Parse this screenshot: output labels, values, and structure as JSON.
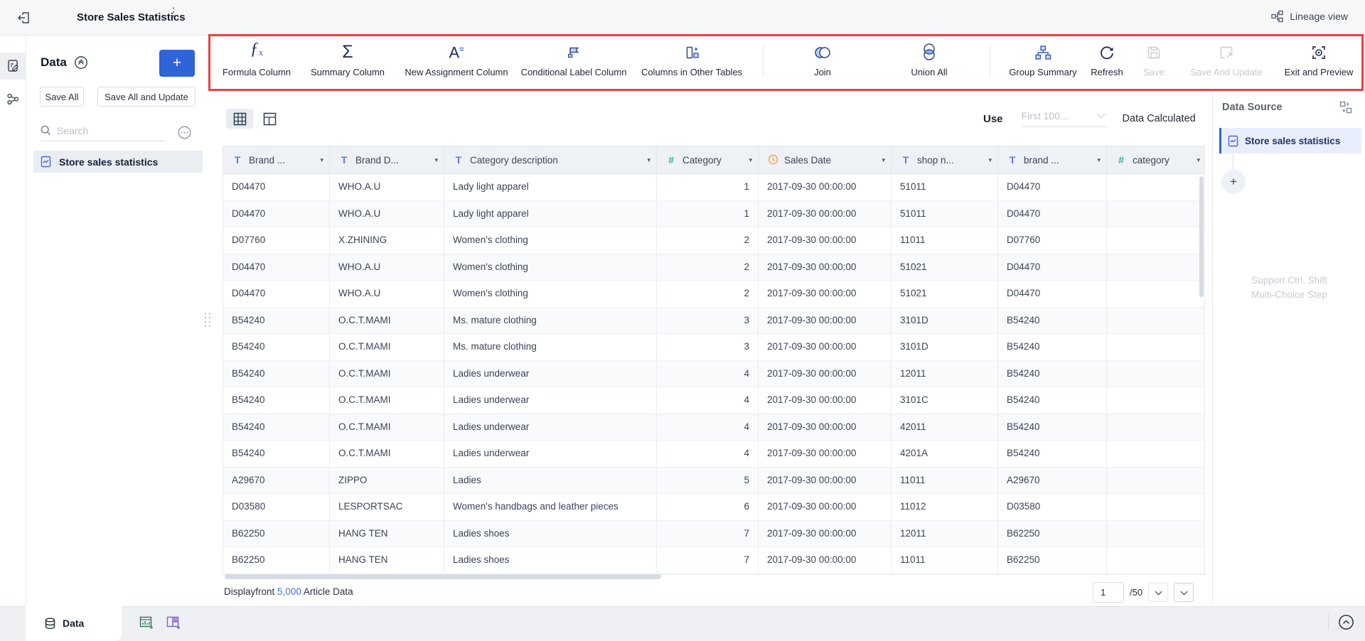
{
  "topbar": {
    "title": "Store Sales Statistics",
    "lineage": "Lineage view"
  },
  "left_panel": {
    "title": "Data",
    "add_label": "+",
    "save_all": "Save All",
    "save_all_and_update": "Save All and Update",
    "search_placeholder": "Search",
    "dataset": "Store sales statistics"
  },
  "toolbar": {
    "items": [
      {
        "label": "Formula Column",
        "icon": "formula-fx-icon",
        "disabled": false
      },
      {
        "label": "Summary Column",
        "icon": "summary-sigma-icon",
        "disabled": false
      },
      {
        "label": "New Assignment Column",
        "icon": "assignment-icon",
        "disabled": false
      },
      {
        "label": "Conditional Label Column",
        "icon": "conditional-flag-icon",
        "disabled": false
      },
      {
        "label": "Columns in Other Tables",
        "icon": "columns-other-tables-icon",
        "disabled": false
      },
      {
        "label": "Join",
        "icon": "join-icon",
        "disabled": false
      },
      {
        "label": "Union All",
        "icon": "union-all-icon",
        "disabled": false
      },
      {
        "label": "Group Summary",
        "icon": "group-summary-icon",
        "disabled": false
      },
      {
        "label": "Refresh",
        "icon": "refresh-icon",
        "disabled": false
      },
      {
        "label": "Save",
        "icon": "save-icon",
        "disabled": true
      },
      {
        "label": "Save And Update",
        "icon": "save-update-icon",
        "disabled": true
      },
      {
        "label": "Exit and Preview",
        "icon": "exit-preview-icon",
        "disabled": false
      }
    ]
  },
  "view_bar": {
    "use": "Use",
    "limit": "First 100...",
    "status": "Data Calculated"
  },
  "table": {
    "columns": [
      {
        "label": "Brand ...",
        "type": "text"
      },
      {
        "label": "Brand D...",
        "type": "text"
      },
      {
        "label": "Category description",
        "type": "text"
      },
      {
        "label": "Category",
        "type": "number"
      },
      {
        "label": "Sales Date",
        "type": "date"
      },
      {
        "label": "shop n...",
        "type": "text"
      },
      {
        "label": "brand ...",
        "type": "text"
      },
      {
        "label": "category",
        "type": "number"
      }
    ],
    "rows": [
      [
        "D04470",
        "WHO.A.U",
        "Lady light apparel",
        "1",
        "2017-09-30 00:00:00",
        "51011",
        "D04470",
        ""
      ],
      [
        "D04470",
        "WHO.A.U",
        "Lady light apparel",
        "1",
        "2017-09-30 00:00:00",
        "51011",
        "D04470",
        ""
      ],
      [
        "D07760",
        "X.ZHINING",
        "Women's clothing",
        "2",
        "2017-09-30 00:00:00",
        "11011",
        "D07760",
        ""
      ],
      [
        "D04470",
        "WHO.A.U",
        "Women's clothing",
        "2",
        "2017-09-30 00:00:00",
        "51021",
        "D04470",
        ""
      ],
      [
        "D04470",
        "WHO.A.U",
        "Women's clothing",
        "2",
        "2017-09-30 00:00:00",
        "51021",
        "D04470",
        ""
      ],
      [
        "B54240",
        "O.C.T.MAMI",
        "Ms. mature clothing",
        "3",
        "2017-09-30 00:00:00",
        "3101D",
        "B54240",
        ""
      ],
      [
        "B54240",
        "O.C.T.MAMI",
        "Ms. mature clothing",
        "3",
        "2017-09-30 00:00:00",
        "3101D",
        "B54240",
        ""
      ],
      [
        "B54240",
        "O.C.T.MAMI",
        "Ladies underwear",
        "4",
        "2017-09-30 00:00:00",
        "12011",
        "B54240",
        ""
      ],
      [
        "B54240",
        "O.C.T.MAMI",
        "Ladies underwear",
        "4",
        "2017-09-30 00:00:00",
        "3101C",
        "B54240",
        ""
      ],
      [
        "B54240",
        "O.C.T.MAMI",
        "Ladies underwear",
        "4",
        "2017-09-30 00:00:00",
        "42011",
        "B54240",
        ""
      ],
      [
        "B54240",
        "O.C.T.MAMI",
        "Ladies underwear",
        "4",
        "2017-09-30 00:00:00",
        "4201A",
        "B54240",
        ""
      ],
      [
        "A29670",
        "ZIPPO",
        "Ladies",
        "5",
        "2017-09-30 00:00:00",
        "11011",
        "A29670",
        ""
      ],
      [
        "D03580",
        "LESPORTSAC",
        "Women's handbags and leather pieces",
        "6",
        "2017-09-30 00:00:00",
        "11012",
        "D03580",
        ""
      ],
      [
        "B62250",
        "HANG TEN",
        "Ladies shoes",
        "7",
        "2017-09-30 00:00:00",
        "12011",
        "B62250",
        ""
      ],
      [
        "B62250",
        "HANG TEN",
        "Ladies shoes",
        "7",
        "2017-09-30 00:00:00",
        "11011",
        "B62250",
        ""
      ]
    ]
  },
  "footer": {
    "prefix": "Displayfront",
    "count": "5,000",
    "suffix": "Article Data",
    "page": "1",
    "total": "/50"
  },
  "right_panel": {
    "title": "Data Source",
    "step": "Store sales statistics",
    "hint1": "Support Ctrl, Shift",
    "hint2": "Multi-Choice Step"
  },
  "bottom_bar": {
    "tab": "Data"
  },
  "colors": {
    "accent": "#2f63d8",
    "annotation": "#f23d3d",
    "text_type_icon": "#5e78f0",
    "number_type_icon": "#2eb39c",
    "date_type_icon": "#f2a74e",
    "link": "#3d6fe0"
  }
}
